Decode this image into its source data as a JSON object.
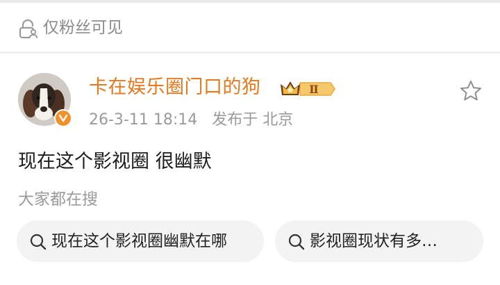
{
  "visibility": {
    "icon": "lock-person-icon",
    "label": "仅粉丝可见"
  },
  "post": {
    "author": {
      "name": "卡在娱乐圈门口的狗",
      "avatar": "beagle-dog-avatar",
      "verified_badge": "verified-v-badge",
      "vip_badge_text": "Ⅱ"
    },
    "date": "26-3-11 18:14",
    "location": "发布于 北京",
    "text": "现在这个影视圈 很幽默"
  },
  "related_search": {
    "caption": "大家都在搜",
    "chips": [
      {
        "label": "现在这个影视圈幽默在哪"
      },
      {
        "label": "影视圈现状有多…"
      }
    ]
  },
  "colors": {
    "author_name": "#e8781d",
    "badge_orange": "#f0912b",
    "chip_bg": "#f3f3f3"
  }
}
